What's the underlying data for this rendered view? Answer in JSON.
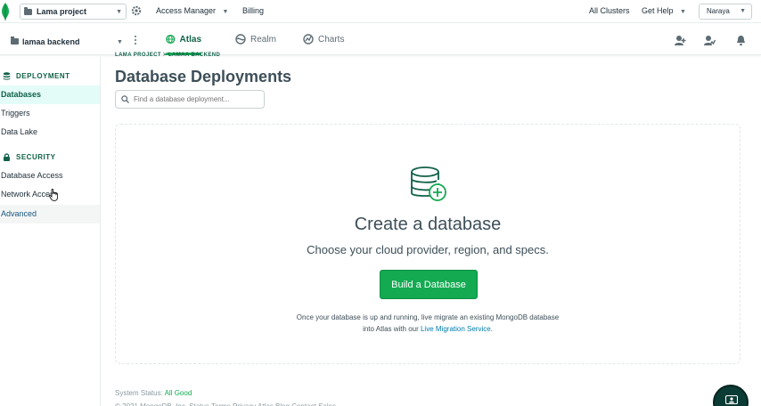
{
  "topbar": {
    "project_name": "Lama project",
    "links": [
      "Access Manager",
      "Billing"
    ],
    "all_clusters": "All Clusters",
    "get_help": "Get Help",
    "user": "Naraya"
  },
  "navbar": {
    "org_name": "lamaa backend",
    "tabs": [
      {
        "label": "Atlas",
        "icon": "atlas-icon",
        "active": true
      },
      {
        "label": "Realm",
        "icon": "realm-icon",
        "active": false
      },
      {
        "label": "Charts",
        "icon": "charts-icon",
        "active": false
      }
    ],
    "right_icons": [
      "invite-user-icon",
      "activity-icon",
      "bell-icon"
    ]
  },
  "sidebar": {
    "deployment": {
      "title": "DEPLOYMENT",
      "items": [
        "Databases",
        "Triggers",
        "Data Lake"
      ]
    },
    "security": {
      "title": "SECURITY",
      "items": [
        "Database Access",
        "Network Access",
        "Advanced"
      ]
    }
  },
  "main": {
    "breadcrumb": "LAMA PROJECT > LAMAA BACKEND",
    "title": "Database Deployments",
    "search_placeholder": "Find a database deployment...",
    "empty": {
      "title": "Create a database",
      "subtitle": "Choose your cloud provider, region, and specs.",
      "button": "Build a Database",
      "note_line1": "Once your database is up and running, live migrate an existing MongoDB database",
      "note_line2_prefix": "into Atlas with our ",
      "note_link": "Live Migration Service",
      "note_line2_suffix": "."
    },
    "status_label": "System Status: ",
    "status_value": "All Good",
    "footer": "© 2021 MongoDB, Inc. Status Terms Privacy Atlas Blog Contact Sales"
  },
  "colors": {
    "brand_green": "#13aa52",
    "dark_green": "#116149",
    "link_blue": "#007cad"
  }
}
